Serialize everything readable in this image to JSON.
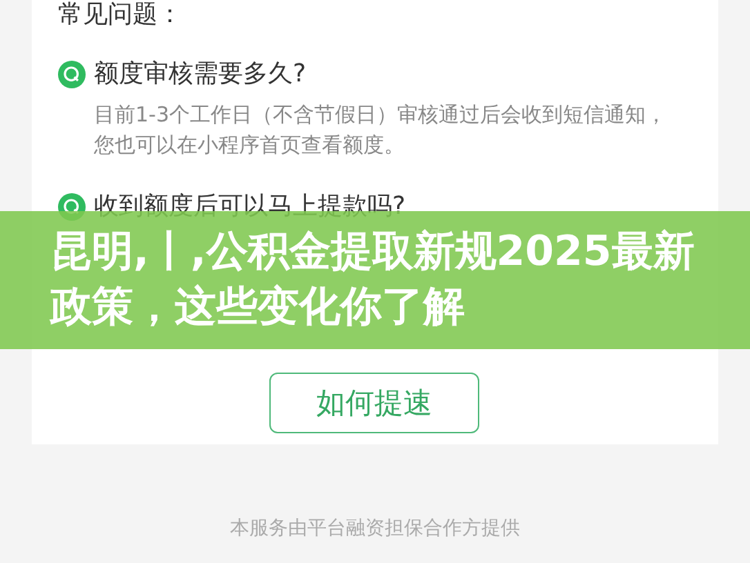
{
  "section_title": "常见问题：",
  "faq": [
    {
      "question": "额度审核需要多久?",
      "answer": "目前1-3个工作日（不含节假日）审核通过后会收到短信通知，您也可以在小程序首页查看额度。"
    },
    {
      "question": "收到额度后可以马上提款吗?"
    }
  ],
  "action_button": "如何提速",
  "banner_title": "昆明,丨,公积金提取新规2025最新政策，这些变化你了解",
  "footer": "本服务由平台融资担保合作方提供"
}
